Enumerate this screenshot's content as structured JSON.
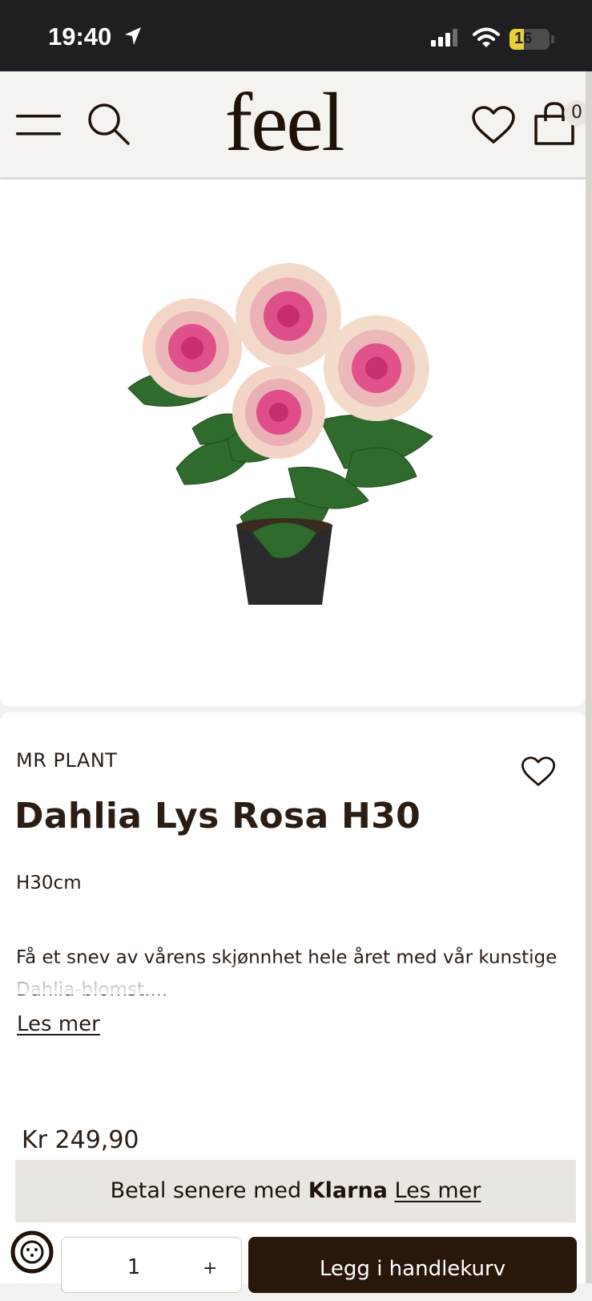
{
  "status_bar": {
    "time": "19:40",
    "battery": "16",
    "battery_level": 0.16,
    "icons": [
      "location-arrow-icon",
      "cellular-signal-icon",
      "wifi-icon",
      "battery-charging-icon"
    ]
  },
  "header": {
    "logo": "feel",
    "cart_count": "0",
    "icons": [
      "menu-icon",
      "search-icon",
      "heart-icon",
      "shopping-bag-icon"
    ]
  },
  "product": {
    "brand": "MR PLANT",
    "title": "Dahlia Lys Rosa H30",
    "size": "H30cm",
    "description": "Få et snev av vårens skjønnhet hele året med vår kunstige Dahlia-blomst....",
    "read_more": "Les mer",
    "price": "Kr 249,90"
  },
  "klarna": {
    "prefix": "Betal senere med ",
    "brand": "Klarna",
    "link": "Les mer"
  },
  "cart": {
    "quantity": "1",
    "plus": "+",
    "add_label": "Legg i handlekurv"
  },
  "colors": {
    "header_bg": "#f5f3ef",
    "text": "#2b1d14",
    "button_bg": "#2a170c",
    "klarna_bg": "#e9e6e2",
    "flower_pink": "#e0508a",
    "leaf_green": "#2f6b2c"
  }
}
